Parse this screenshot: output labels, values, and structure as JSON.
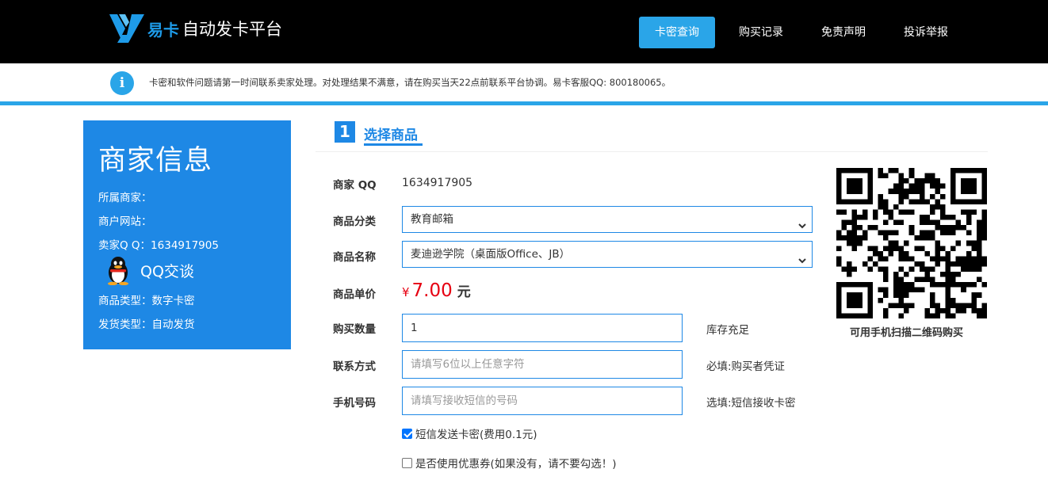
{
  "header": {
    "brand": "易卡",
    "title": "自动发卡平台",
    "nav": [
      {
        "label": "卡密查询",
        "active": true
      },
      {
        "label": "购买记录",
        "active": false
      },
      {
        "label": "免责声明",
        "active": false
      },
      {
        "label": "投诉举报",
        "active": false
      }
    ],
    "accent_color": "#2aa5e8"
  },
  "notice": {
    "icon": "info-icon",
    "text": "卡密和软件问题请第一时间联系卖家处理。对处理结果不满意，请在购买当天22点前联系平台协调。易卡客服QQ: 800180065。"
  },
  "merchant": {
    "title": "商家信息",
    "owner_label": "所属商家：",
    "website_label": "商户网站：",
    "qq_label": "卖家Q Q：",
    "qq_value": "1634917905",
    "qq_chat_label": "QQ交谈",
    "product_type_label": "商品类型：",
    "product_type_value": "数字卡密",
    "delivery_label": "发货类型：",
    "delivery_value": "自动发货",
    "panel_color": "#1e88e5"
  },
  "step": {
    "number": "1",
    "title": "选择商品"
  },
  "form": {
    "merchant_qq": {
      "label": "商家 QQ",
      "value": "1634917905"
    },
    "category": {
      "label": "商品分类",
      "value": "教育邮箱"
    },
    "product": {
      "label": "商品名称",
      "value": "麦迪逊学院（桌面版Office、JB）"
    },
    "price": {
      "label": "商品单价",
      "symbol": "¥",
      "value": "7.00",
      "unit": "元"
    },
    "quantity": {
      "label": "购买数量",
      "value": "1",
      "hint": "库存充足"
    },
    "contact": {
      "label": "联系方式",
      "placeholder": "请填写6位以上任意字符",
      "hint": "必填:购买者凭证"
    },
    "phone": {
      "label": "手机号码",
      "placeholder": "请填写接收短信的号码",
      "hint": "选填:短信接收卡密"
    },
    "sms_option": {
      "label": "短信发送卡密(费用0.1元)",
      "checked": true
    },
    "coupon_option": {
      "label": "是否使用优惠券(如果没有，请不要勾选！)",
      "checked": false
    }
  },
  "qr": {
    "caption": "可用手机扫描二维码购买"
  }
}
